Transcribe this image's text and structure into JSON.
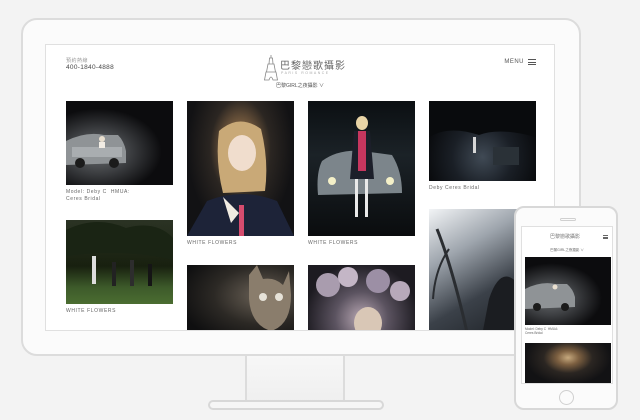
{
  "desktop": {
    "header": {
      "contact_label": "預約熱線",
      "phone": "400-1840-4888",
      "logo_text": "巴黎戀歌攝影",
      "logo_sub": "PARIS ROMANCE",
      "menu_label": "MENU"
    },
    "category": "巴黎GIRL之夜攝影 ∨",
    "tiles": [
      {
        "caption": "Model: Deby C  HMUA:\nCeres Bridal"
      },
      {
        "caption": "WHITE FLOWERS"
      },
      {
        "caption": "WHITE FLOWERS"
      },
      {
        "caption": "Deby Ceres Bridal"
      },
      {
        "caption": "WHITE FLOWERS"
      },
      {
        "caption": ""
      },
      {
        "caption": ""
      },
      {
        "caption": ""
      }
    ]
  },
  "mobile": {
    "logo_text": "巴黎戀歌攝影",
    "category": "巴黎GIRL之夜攝影 ∨",
    "caption": "Model: Deby C  HMUA:\nCeres Bridal"
  },
  "colors": {
    "frame": "#dcdcdc",
    "background": "#f3f3f3"
  }
}
